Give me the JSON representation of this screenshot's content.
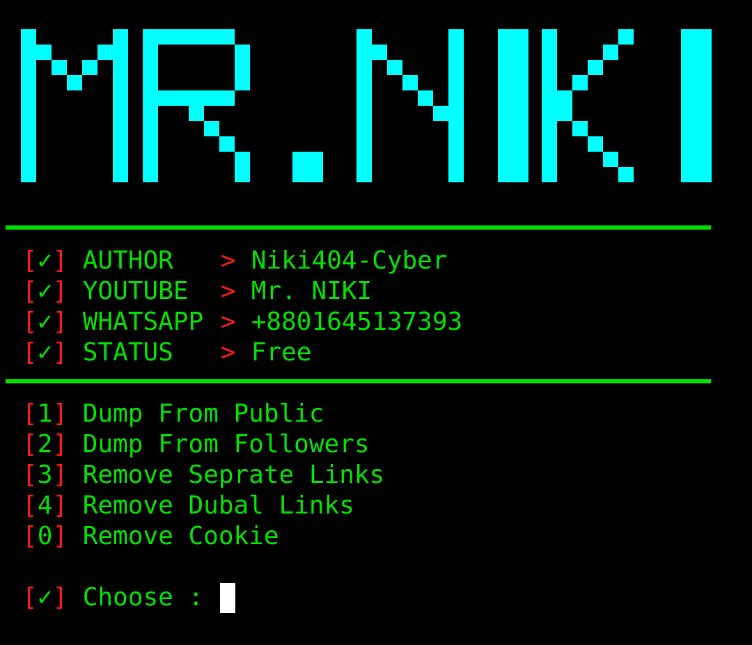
{
  "banner": {
    "text": "MR.NIKI",
    "color": "#00ffff"
  },
  "colors": {
    "text": "#00e000",
    "bracket": "#ff1a1a",
    "background": "#000000",
    "cursor": "#ffffff"
  },
  "info": [
    {
      "mark": "✓",
      "key": "AUTHOR",
      "arrow": ">",
      "value": "Niki404-Cyber"
    },
    {
      "mark": "✓",
      "key": "YOUTUBE",
      "arrow": ">",
      "value": "Mr. NIKI"
    },
    {
      "mark": "✓",
      "key": "WHATSAPP",
      "arrow": ">",
      "value": "+8801645137393"
    },
    {
      "mark": "✓",
      "key": "STATUS",
      "arrow": ">",
      "value": "Free"
    }
  ],
  "menu": [
    {
      "num": "1",
      "label": "Dump From Public"
    },
    {
      "num": "2",
      "label": "Dump From Followers"
    },
    {
      "num": "3",
      "label": "Remove Seprate Links"
    },
    {
      "num": "4",
      "label": "Remove Dubal Links"
    },
    {
      "num": "0",
      "label": "Remove Cookie"
    }
  ],
  "prompt": {
    "mark": "✓",
    "label": "Choose : "
  }
}
